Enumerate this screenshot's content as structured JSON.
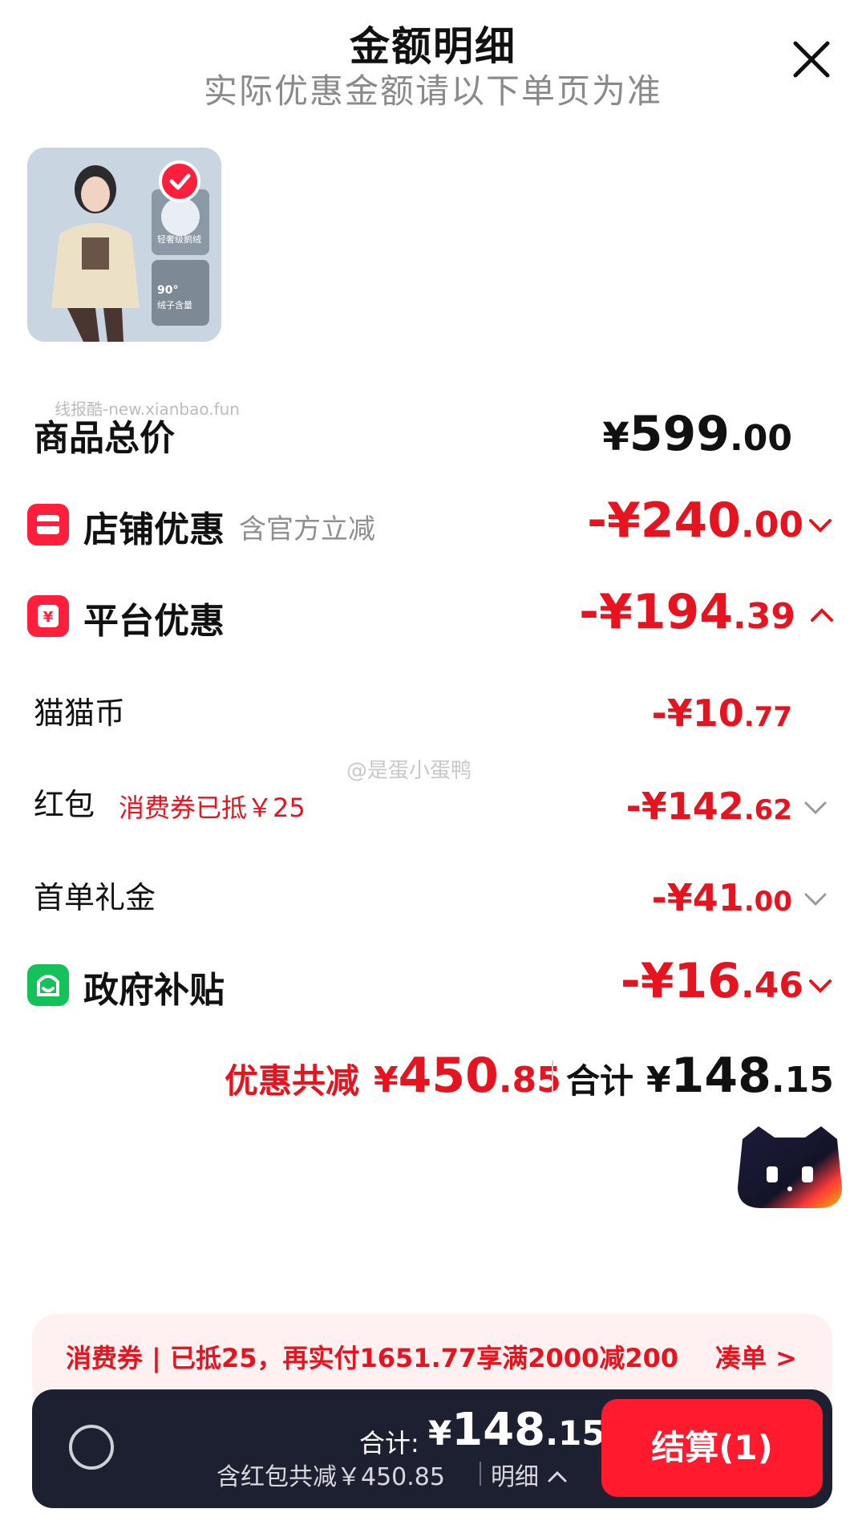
{
  "header": {
    "title": "金额明细",
    "subtitle": "实际优惠金额请以下单页为准"
  },
  "product": {
    "thumb_caption_1": "轻奢级鹅绒",
    "thumb_caption_2": "90°",
    "thumb_caption_3": "绒子含量"
  },
  "watermarks": {
    "site": "线报酷-new.xianbao.fun",
    "weibo": "@是蛋小蛋鸭"
  },
  "rows": {
    "total": {
      "label": "商品总价",
      "currency": "¥",
      "int": "599",
      "dec": ".00"
    },
    "store": {
      "label": "店铺优惠",
      "note": "含官方立减",
      "prefix": "-¥",
      "int": "240",
      "dec": ".00"
    },
    "platform": {
      "label": "平台优惠",
      "prefix": "-¥",
      "int": "194",
      "dec": ".39"
    },
    "coin": {
      "label": "猫猫币",
      "prefix": "-¥",
      "int": "10",
      "dec": ".77"
    },
    "hongbao": {
      "label": "红包",
      "note": "消费券已抵￥25",
      "prefix": "-¥",
      "int": "142",
      "dec": ".62"
    },
    "first_order": {
      "label": "首单礼金",
      "prefix": "-¥",
      "int": "41",
      "dec": ".00"
    },
    "gov": {
      "label": "政府补贴",
      "prefix": "-¥",
      "int": "16",
      "dec": ".46"
    }
  },
  "summary": {
    "discount_label": "优惠共减",
    "discount_currency": "¥",
    "discount_int": "450",
    "discount_dec": ".85",
    "total_label": "合计",
    "total_currency": "¥",
    "total_int": "148",
    "total_dec": ".15"
  },
  "coupon": {
    "text": "消费券 | 已抵25，再实付1651.77享满2000减200",
    "link": "凑单 >"
  },
  "bottom_bar": {
    "total_label": "合计:",
    "currency": "¥",
    "total_int": "148",
    "total_dec": ".15",
    "sub": "含红包共减￥450.85",
    "detail_link": "明细",
    "pay_button": "结算(1)"
  },
  "colors": {
    "accent_red": "#e5141e",
    "gov_green": "#15c25a",
    "bar_bg": "#1d2030"
  }
}
